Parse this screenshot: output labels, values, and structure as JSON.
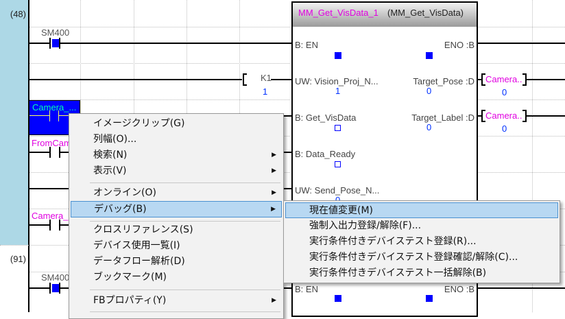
{
  "rungs": [
    {
      "number": "(48)"
    },
    {
      "number": "(91)"
    }
  ],
  "contacts": {
    "sm400": "SM400",
    "camera_selected": "Camera_...",
    "from_cam": "FromCam",
    "camera_lower": "Camera_",
    "sm400_2": "SM400"
  },
  "coil_k1": {
    "device": "K1",
    "value": "1"
  },
  "fb": {
    "instance": "MM_Get_VisData_1",
    "type": "(MM_Get_VisData)",
    "inputs": [
      {
        "label": "B: EN"
      },
      {
        "label": "UW: Vision_Proj_N...",
        "value": "1"
      },
      {
        "label": "B: Get_VisData"
      },
      {
        "label": "B: Data_Ready"
      },
      {
        "label": "UW: Send_Pose_N...",
        "value": "0"
      }
    ],
    "outputs": [
      {
        "label": "ENO :B"
      },
      {
        "label": "Target_Pose :D",
        "value": "0",
        "device": "Camera...",
        "device_value": "0"
      },
      {
        "label": "Target_Label :D",
        "value": "0",
        "device": "Camera...",
        "device_value": "0"
      }
    ],
    "lower": {
      "en": "B: EN",
      "eno": "ENO :B"
    }
  },
  "context_menu": {
    "items": [
      {
        "label": "イメージクリップ(G)"
      },
      {
        "label": "列幅(O)..."
      },
      {
        "label": "検索(N)",
        "submenu": true
      },
      {
        "label": "表示(V)",
        "submenu": true
      },
      {
        "label": "オンライン(O)",
        "submenu": true
      },
      {
        "label": "デバッグ(B)",
        "submenu": true,
        "highlighted": true
      },
      {
        "label": "クロスリファレンス(S)"
      },
      {
        "label": "デバイス使用一覧(I)"
      },
      {
        "label": "データフロー解析(D)"
      },
      {
        "label": "ブックマーク(M)"
      },
      {
        "label": "FBプロパティ(Y)",
        "submenu": true
      }
    ],
    "submenu_arrow": "▶"
  },
  "debug_submenu": {
    "items": [
      {
        "label": "現在値変更(M)",
        "highlighted": true
      },
      {
        "label": "強制入出力登録/解除(F)..."
      },
      {
        "label": "実行条件付きデバイステスト登録(R)..."
      },
      {
        "label": "実行条件付きデバイステスト登録確認/解除(C)..."
      },
      {
        "label": "実行条件付きデバイステスト一括解除(B)"
      }
    ]
  },
  "colors": {
    "gutter": "#add8e6",
    "highlight": "#b8d8f2",
    "selection": "#0000ff",
    "label_magenta": "#e000e0",
    "value_blue": "#0030ff"
  }
}
